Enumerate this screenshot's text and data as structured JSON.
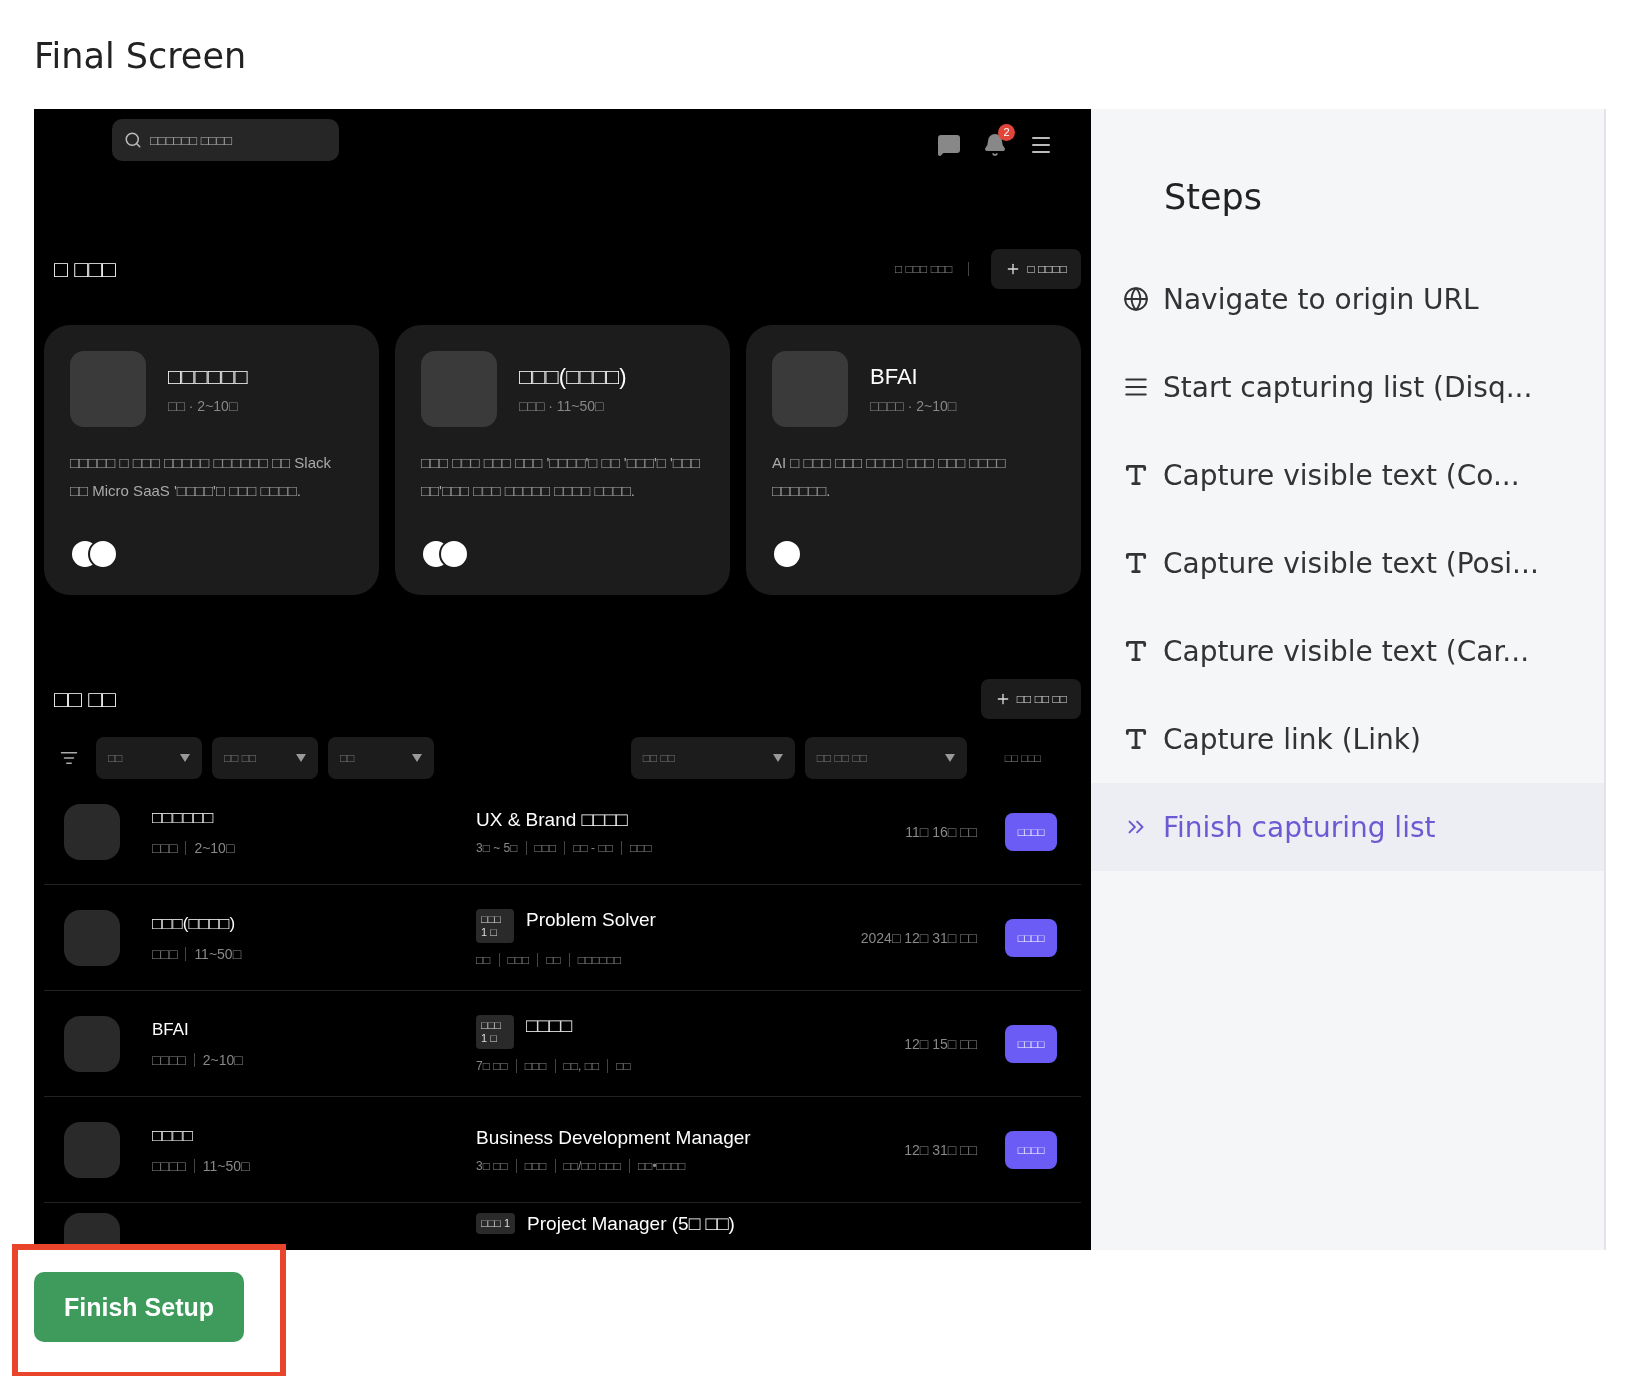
{
  "page_title": "Final Screen",
  "app": {
    "search": {
      "placeholder": "□□□□□□ □□□□"
    },
    "notification_count": "2",
    "teams": {
      "title": "□ □□□",
      "link": "□ □□□ □□□",
      "button": "□ □□□□",
      "cards": [
        {
          "name": "□□□□□□",
          "meta": "□□ · 2~10□",
          "description": "□□□□□ □ □□□ □□□□□ □□□□□□ □□ Slack □□ Micro SaaS '□□□□'□ □□□ □□□□.",
          "members": [
            {
              "kind": "avatar"
            },
            {
              "kind": "avatar"
            }
          ]
        },
        {
          "name": "□□□(□□□□)",
          "meta": "□□□ · 11~50□",
          "description": "□□□ □□□ □□□ □□□ '□□□□'□ □□ '□□□'□ '□□□ □□'□□□ □□□ □□□□□ □□□□ □□□□.",
          "members": [
            {
              "kind": "avatar"
            },
            {
              "kind": "avatar"
            }
          ]
        },
        {
          "name": "BFAI",
          "meta": "□□□□ · 2~10□",
          "description": "AI □ □□□ □□□ □□□□ □□□ □□□ □□□□ □□□□□□.",
          "members": [
            {
              "kind": "avatar"
            }
          ]
        }
      ]
    },
    "jobs": {
      "title": "□□ □□",
      "button": "□□ □□ □□",
      "filters_left": [
        "□□",
        "□□ □□",
        "□□"
      ],
      "filters_right": [
        "□□ □□",
        "□□ □□ □□"
      ],
      "sort": "□□ □□□",
      "rows": [
        {
          "company": "□□□□□□",
          "company_meta": [
            "□□□",
            "2~10□"
          ],
          "title": "UX & Brand □□□□",
          "details": [
            "3□ ~ 5□",
            "□□□",
            "□□ - □□",
            "□□□"
          ],
          "date": "11□ 16□ □□",
          "button": "□□□□"
        },
        {
          "company": "□□□(□□□□)",
          "company_meta": [
            "□□□",
            "11~50□"
          ],
          "tag": "□□□ 1 □",
          "title": "Problem Solver",
          "details": [
            "□□",
            "□□□",
            "□□",
            "□□□□□□"
          ],
          "date": "2024□ 12□ 31□ □□",
          "button": "□□□□"
        },
        {
          "company": "BFAI",
          "company_meta": [
            "□□□□",
            "2~10□"
          ],
          "tag": "□□□ 1 □",
          "title": "□□□□",
          "details": [
            "7□ □□",
            "□□□",
            "□□, □□",
            "□□"
          ],
          "date": "12□ 15□ □□",
          "button": "□□□□"
        },
        {
          "company": "□□□□",
          "company_meta": [
            "□□□□",
            "11~50□"
          ],
          "title": "Business Development Manager",
          "details": [
            "3□ □□",
            "□□□",
            "□□/□□ □□□",
            "□□•□□□□"
          ],
          "date": "12□ 31□ □□",
          "button": "□□□□"
        },
        {
          "tag": "□□□ 1",
          "title": "Project Manager (5□ □□)"
        }
      ]
    }
  },
  "steps": {
    "title": "Steps",
    "items": [
      {
        "kind": "navigate",
        "label": "Navigate to origin URL",
        "selected": false
      },
      {
        "kind": "list",
        "label": "Start capturing list (Disq...",
        "selected": false
      },
      {
        "kind": "text",
        "label": "Capture visible text (Co...",
        "selected": false
      },
      {
        "kind": "text",
        "label": "Capture visible text (Posi...",
        "selected": false
      },
      {
        "kind": "text",
        "label": "Capture visible text (Car...",
        "selected": false
      },
      {
        "kind": "text",
        "label": "Capture link (Link)",
        "selected": false
      },
      {
        "kind": "finish",
        "label": "Finish capturing list",
        "selected": true
      }
    ]
  },
  "finish_button": {
    "label": "Finish Setup",
    "highlighted": true
  }
}
